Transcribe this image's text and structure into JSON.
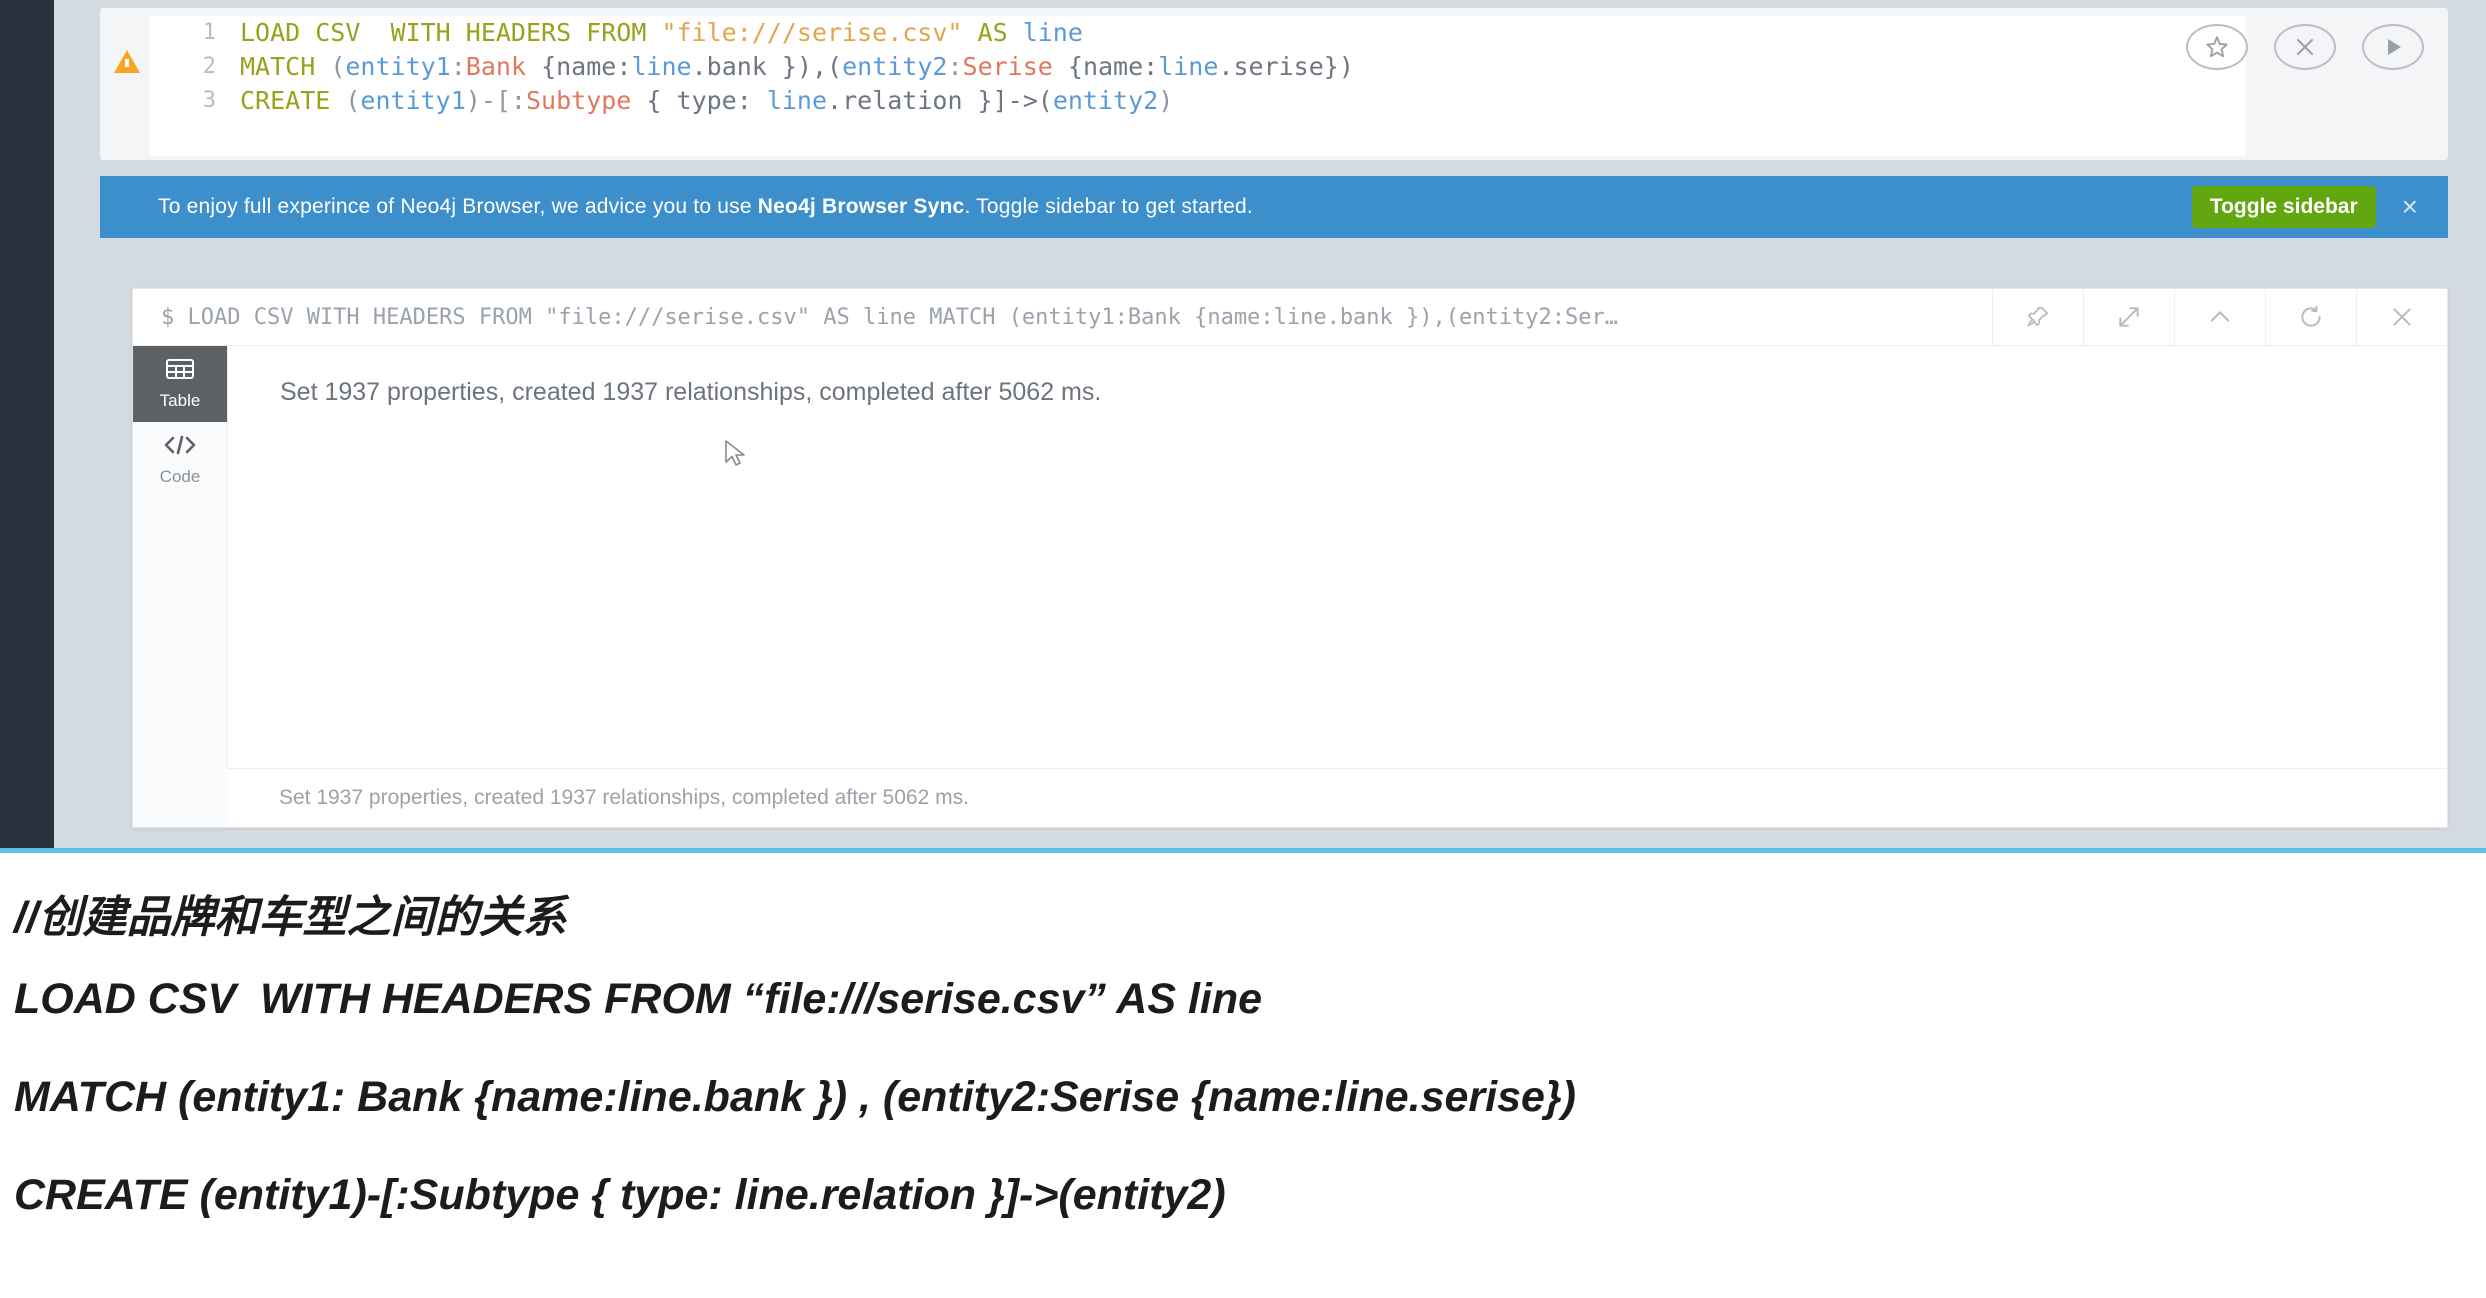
{
  "editor": {
    "lines": [
      {
        "number": "1",
        "tokens": [
          {
            "t": "LOAD CSV  WITH HEADERS FROM ",
            "c": "kw"
          },
          {
            "t": "\"file:///serise.csv\"",
            "c": "str"
          },
          {
            "t": " AS ",
            "c": "kw"
          },
          {
            "t": "line",
            "c": "var"
          }
        ]
      },
      {
        "number": "2",
        "tokens": [
          {
            "t": "MATCH ",
            "c": "kw"
          },
          {
            "t": "(",
            "c": "punct"
          },
          {
            "t": "entity1",
            "c": "var"
          },
          {
            "t": ":",
            "c": "punct"
          },
          {
            "t": "Bank",
            "c": "label"
          },
          {
            "t": " {name:",
            "c": "plain"
          },
          {
            "t": "line",
            "c": "var"
          },
          {
            "t": ".bank }),(",
            "c": "plain"
          },
          {
            "t": "entity2",
            "c": "var"
          },
          {
            "t": ":",
            "c": "punct"
          },
          {
            "t": "Serise",
            "c": "label"
          },
          {
            "t": " {name:",
            "c": "plain"
          },
          {
            "t": "line",
            "c": "var"
          },
          {
            "t": ".serise})",
            "c": "plain"
          }
        ]
      },
      {
        "number": "3",
        "tokens": [
          {
            "t": "CREATE ",
            "c": "kw"
          },
          {
            "t": "(",
            "c": "punct"
          },
          {
            "t": "entity1",
            "c": "var"
          },
          {
            "t": ")-[:",
            "c": "punct"
          },
          {
            "t": "Subtype",
            "c": "label"
          },
          {
            "t": " { type: ",
            "c": "plain"
          },
          {
            "t": "line",
            "c": "var"
          },
          {
            "t": ".relation }]->(",
            "c": "plain"
          },
          {
            "t": "entity2",
            "c": "var"
          },
          {
            "t": ")",
            "c": "punct"
          }
        ]
      }
    ],
    "warning_icon": "warning-triangle-icon",
    "actions": [
      {
        "name": "favorite-star-icon",
        "label": "Favorite"
      },
      {
        "name": "clear-editor-icon",
        "label": "Clear"
      },
      {
        "name": "run-query-icon",
        "label": "Run"
      }
    ]
  },
  "notification": {
    "text_before": "To enjoy full experince of Neo4j Browser, we advice you to use ",
    "text_bold": "Neo4j Browser Sync",
    "text_after": ". Toggle sidebar to get started.",
    "button_label": "Toggle sidebar",
    "close_label": "×",
    "background_color": "#3d8fcc",
    "button_color": "#62a70f"
  },
  "frame": {
    "command": "$ LOAD CSV WITH HEADERS FROM \"file:///serise.csv\" AS line MATCH (entity1:Bank {name:line.bank }),(entity2:Ser…",
    "tools": [
      {
        "name": "pin-icon",
        "label": "Pin"
      },
      {
        "name": "expand-icon",
        "label": "Fullscreen"
      },
      {
        "name": "collapse-chevron-up-icon",
        "label": "Collapse"
      },
      {
        "name": "refresh-icon",
        "label": "Rerun"
      },
      {
        "name": "close-icon",
        "label": "Close"
      }
    ],
    "view_tabs": [
      {
        "label": "Table",
        "icon": "table-grid-icon",
        "active": true
      },
      {
        "label": "Code",
        "icon": "code-brackets-icon",
        "active": false
      }
    ],
    "result_message": "Set 1937 properties, created 1937 relationships, completed after 5062 ms.",
    "status_message": "Set 1937 properties, created 1937 relationships, completed after 5062 ms."
  },
  "document": {
    "comment": "//创建品牌和车型之间的关系",
    "line1": "LOAD CSV  WITH HEADERS FROM “file:///serise.csv” AS line",
    "line2": "MATCH (entity1: Bank {name:line.bank }) , (entity2:Serise {name:line.serise})",
    "line3": "CREATE (entity1)-[:Subtype { type: line.relation }]->(entity2)",
    "accent_color": "#5cc0e8"
  }
}
